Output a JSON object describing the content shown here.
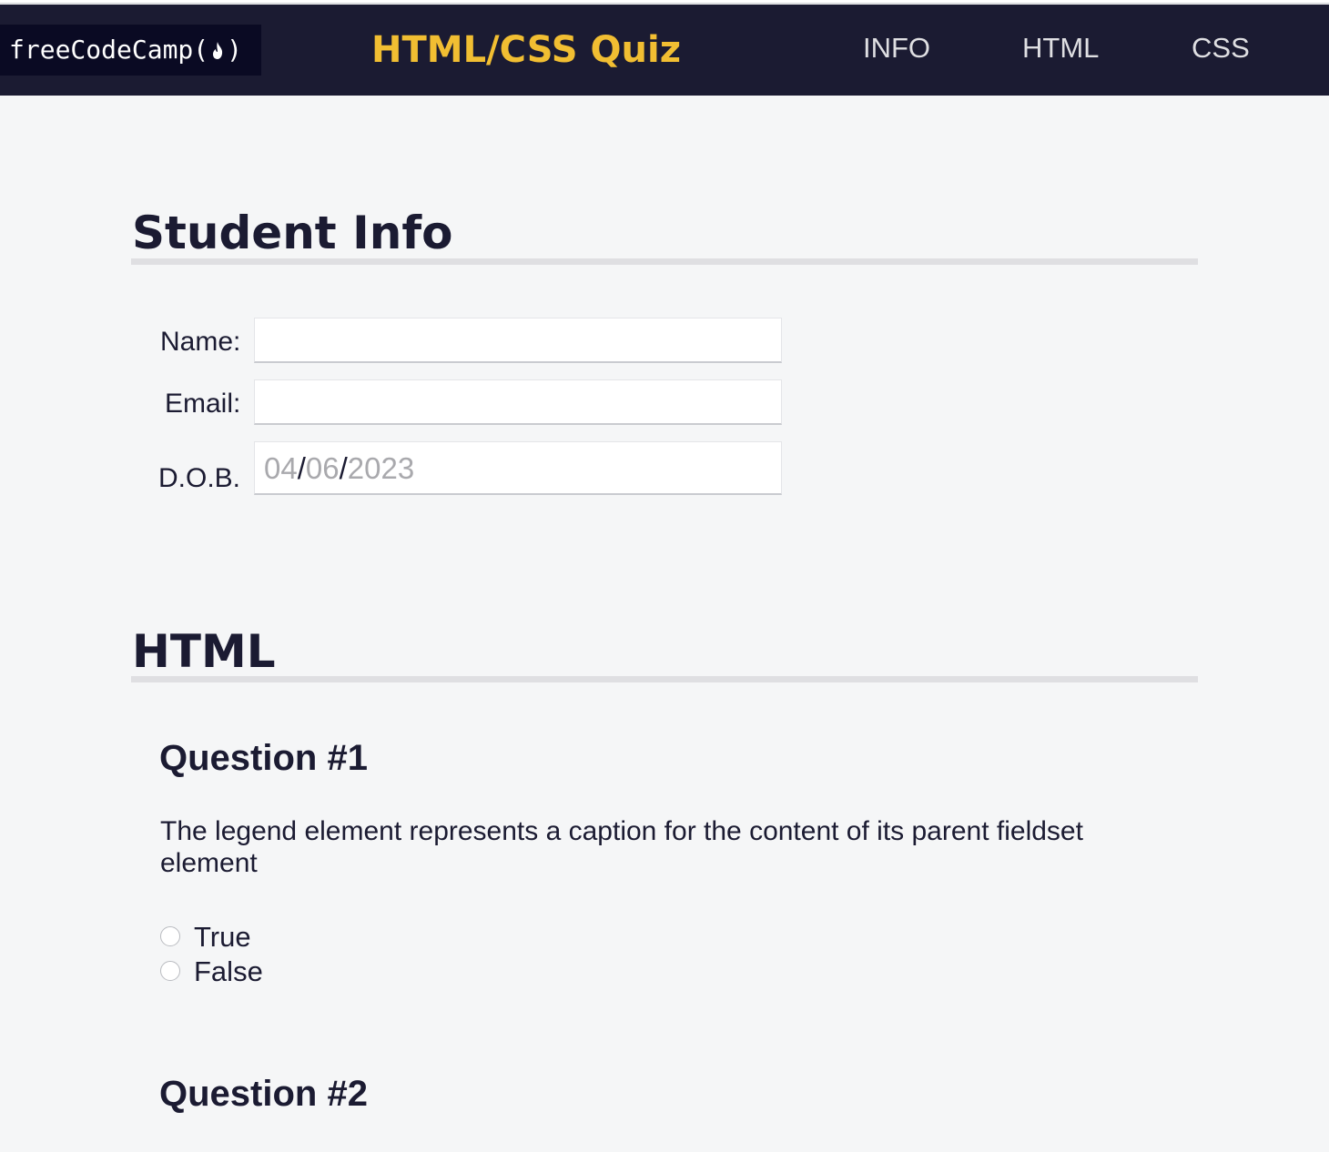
{
  "navbar": {
    "logo_text": "freeCodeCamp(",
    "logo_close": ")",
    "logo_icon": "flame-icon",
    "title": "HTML/CSS Quiz",
    "title_color": "#f1be32",
    "links": [
      {
        "label": "INFO"
      },
      {
        "label": "HTML"
      },
      {
        "label": "CSS"
      }
    ]
  },
  "student_info": {
    "heading": "Student Info",
    "name_label": "Name:",
    "name_value": "",
    "email_label": "Email:",
    "email_value": "",
    "dob_label": "D.O.B.",
    "dob_month": "04",
    "dob_day": "06",
    "dob_year": "2023",
    "dob_separator": "/"
  },
  "html_section": {
    "heading": "HTML",
    "questions": [
      {
        "title": "Question #1",
        "text": "The legend element represents a caption for the content of its parent fieldset element",
        "options": [
          "True",
          "False"
        ],
        "selected": null
      },
      {
        "title": "Question #2"
      }
    ]
  },
  "colors": {
    "navbar_bg": "#1b1b32",
    "page_bg": "#f5f6f7",
    "text": "#1b1b32",
    "accent": "#f1be32"
  }
}
